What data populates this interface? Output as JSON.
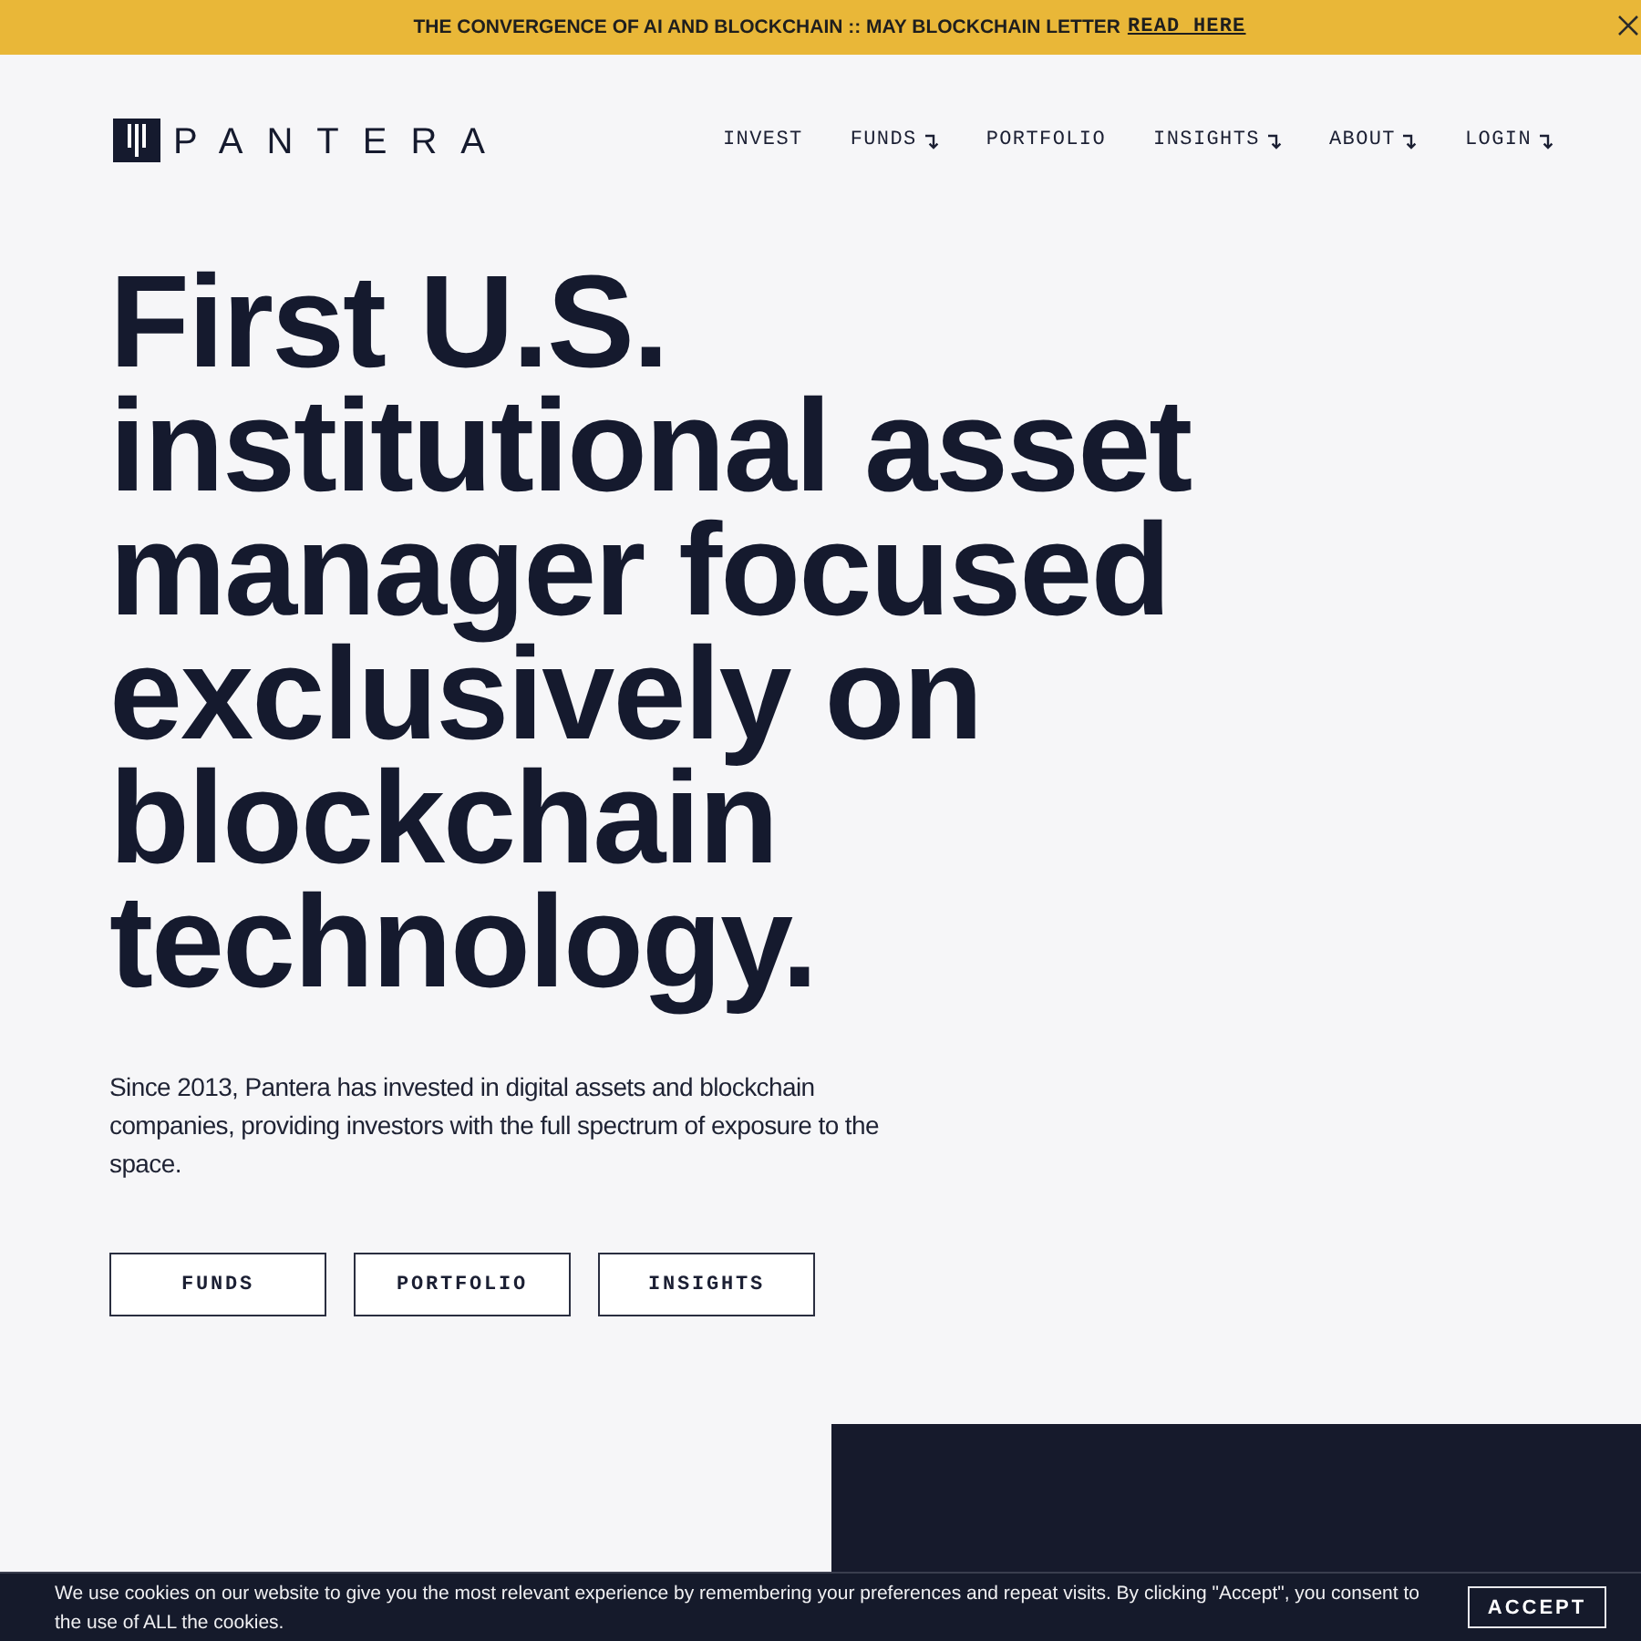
{
  "announcement": {
    "text": "THE CONVERGENCE OF AI AND BLOCKCHAIN :: MAY BLOCKCHAIN LETTER",
    "link": "READ HERE"
  },
  "header": {
    "logo": "PANTERA",
    "nav": [
      {
        "label": "INVEST",
        "dropdown": false
      },
      {
        "label": "FUNDS",
        "dropdown": true
      },
      {
        "label": "PORTFOLIO",
        "dropdown": false
      },
      {
        "label": "INSIGHTS",
        "dropdown": true
      },
      {
        "label": "ABOUT",
        "dropdown": true
      },
      {
        "label": "LOGIN",
        "dropdown": true
      }
    ]
  },
  "hero": {
    "headline": "First U.S. institutional asset manager focused exclusively on blockchain technology.",
    "text": "Since 2013, Pantera has invested in digital assets and blockchain companies, providing investors with the full spectrum of exposure to the space.",
    "buttons": [
      "FUNDS",
      "PORTFOLIO",
      "INSIGHTS"
    ]
  },
  "cookie_banner": {
    "text": "We use cookies on our website to give you the most relevant experience by remembering your preferences and repeat visits. By clicking \"Accept\", you consent to the use of ALL the cookies.",
    "button": "ACCEPT"
  }
}
